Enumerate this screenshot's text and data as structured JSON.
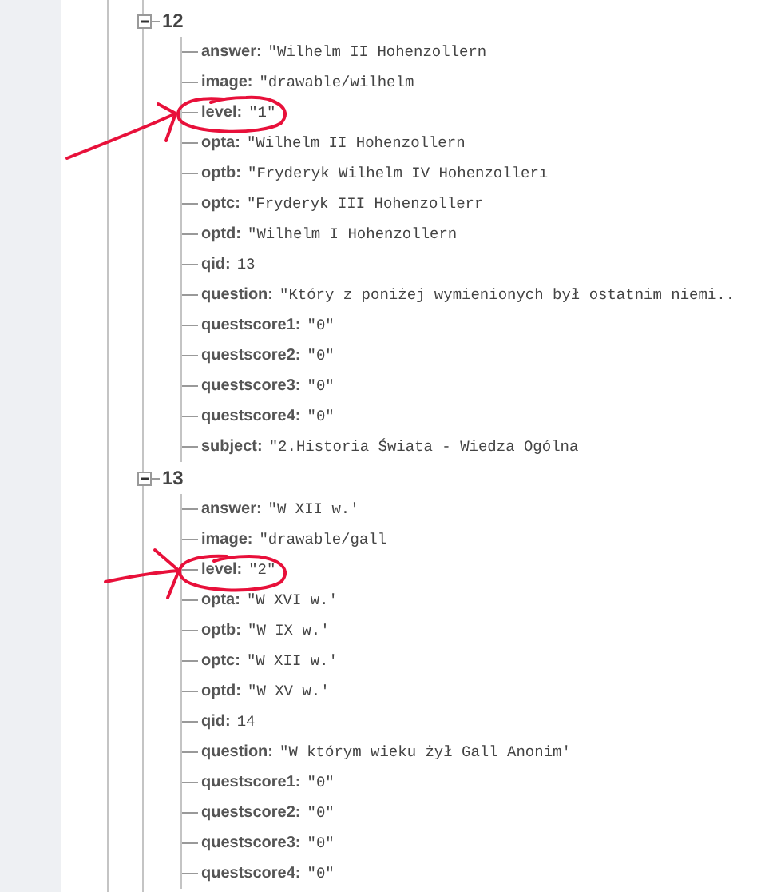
{
  "tree": [
    {
      "key": "12",
      "expanded": true,
      "children": [
        {
          "key": "answer:",
          "value": "\"Wilhelm II Hohenzollern"
        },
        {
          "key": "image:",
          "value": "\"drawable/wilhelm"
        },
        {
          "key": "level:",
          "value": "\"1\""
        },
        {
          "key": "opta:",
          "value": "\"Wilhelm II Hohenzollern"
        },
        {
          "key": "optb:",
          "value": "\"Fryderyk Wilhelm IV Hohenzollerı"
        },
        {
          "key": "optc:",
          "value": "\"Fryderyk III Hohenzollerr"
        },
        {
          "key": "optd:",
          "value": "\"Wilhelm I Hohenzollern"
        },
        {
          "key": "qid:",
          "value": "13"
        },
        {
          "key": "question:",
          "value": "\"Który z poniżej wymienionych był ostatnim niemi.."
        },
        {
          "key": "questscore1:",
          "value": "\"0\""
        },
        {
          "key": "questscore2:",
          "value": "\"0\""
        },
        {
          "key": "questscore3:",
          "value": "\"0\""
        },
        {
          "key": "questscore4:",
          "value": "\"0\""
        },
        {
          "key": "subject:",
          "value": "\"2.Historia Świata - Wiedza Ogólna"
        }
      ]
    },
    {
      "key": "13",
      "expanded": true,
      "children": [
        {
          "key": "answer:",
          "value": "\"W XII w.'"
        },
        {
          "key": "image:",
          "value": "\"drawable/gall"
        },
        {
          "key": "level:",
          "value": "\"2\""
        },
        {
          "key": "opta:",
          "value": "\"W XVI w.'"
        },
        {
          "key": "optb:",
          "value": "\"W IX w.'"
        },
        {
          "key": "optc:",
          "value": "\"W XII w.'"
        },
        {
          "key": "optd:",
          "value": "\"W XV w.'"
        },
        {
          "key": "qid:",
          "value": "14"
        },
        {
          "key": "question:",
          "value": "\"W którym wieku żył Gall Anonim'"
        },
        {
          "key": "questscore1:",
          "value": "\"0\""
        },
        {
          "key": "questscore2:",
          "value": "\"0\""
        },
        {
          "key": "questscore3:",
          "value": "\"0\""
        },
        {
          "key": "questscore4:",
          "value": "\"0\""
        }
      ]
    }
  ]
}
